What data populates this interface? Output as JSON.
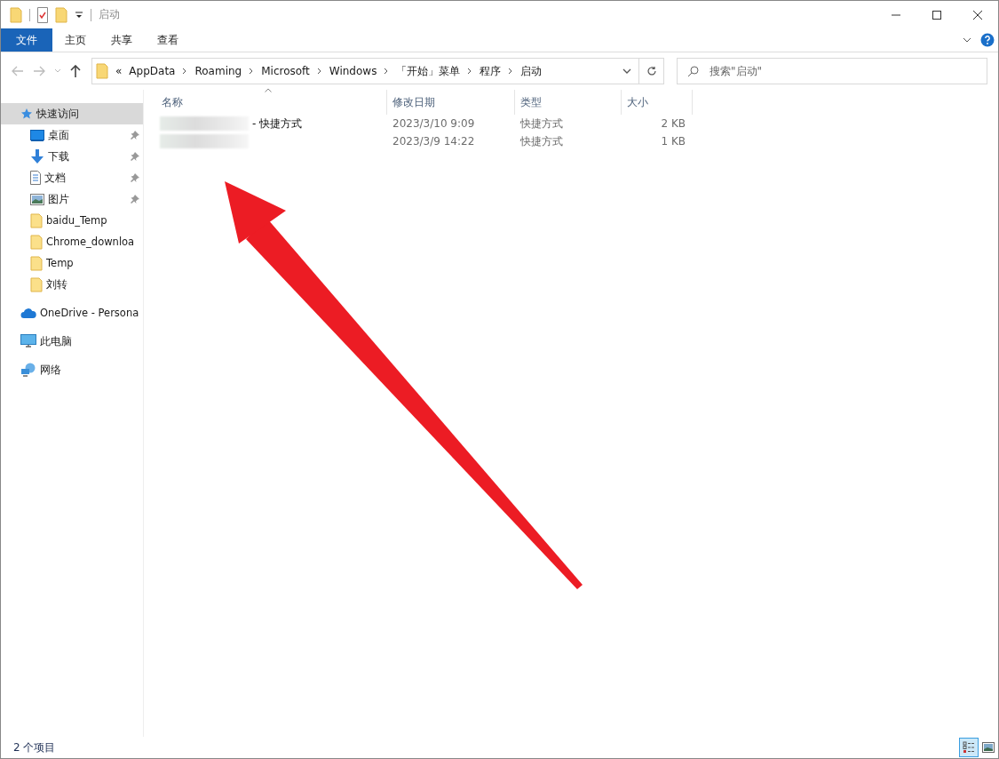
{
  "window": {
    "title": "启动"
  },
  "ribbon_tabs": [
    {
      "label": "文件",
      "kind": "file",
      "selected": false
    },
    {
      "label": "主页",
      "kind": "tab",
      "selected": false
    },
    {
      "label": "共享",
      "kind": "tab",
      "selected": false
    },
    {
      "label": "查看",
      "kind": "tab",
      "selected": false
    }
  ],
  "address_bar": {
    "overflow": "«",
    "crumbs": [
      "AppData",
      "Roaming",
      "Microsoft",
      "Windows",
      "「开始」菜单",
      "程序",
      "启动"
    ]
  },
  "search": {
    "placeholder": "搜索\"启动\""
  },
  "sidebar": {
    "items": [
      {
        "label": "快速访问",
        "kind": "star",
        "selected": true,
        "children": [
          {
            "label": "桌面",
            "kind": "desktop",
            "pinned": true,
            "selected": false
          },
          {
            "label": "下载",
            "kind": "download",
            "pinned": true,
            "selected": false
          },
          {
            "label": "文档",
            "kind": "document",
            "pinned": true,
            "selected": false
          },
          {
            "label": "图片",
            "kind": "picture",
            "pinned": true,
            "selected": false
          },
          {
            "label": "baidu_Temp",
            "kind": "folder",
            "pinned": false,
            "selected": false
          },
          {
            "label": "Chrome_downloa",
            "kind": "folder",
            "pinned": false,
            "selected": false
          },
          {
            "label": "Temp",
            "kind": "folder",
            "pinned": false,
            "selected": false
          },
          {
            "label": "刘转",
            "kind": "folder",
            "pinned": false,
            "selected": false
          }
        ]
      },
      {
        "label": "OneDrive - Persona",
        "kind": "onedrive",
        "selected": false
      },
      {
        "label": "此电脑",
        "kind": "pc",
        "selected": false
      },
      {
        "label": "网络",
        "kind": "network",
        "selected": false
      }
    ]
  },
  "table": {
    "columns": [
      {
        "label": "名称",
        "sorted": true
      },
      {
        "label": "修改日期",
        "sorted": false
      },
      {
        "label": "类型",
        "sorted": false
      },
      {
        "label": "大小",
        "sorted": false
      }
    ],
    "rows": [
      {
        "name": "- 快捷方式",
        "redacted": true,
        "modified": "2023/3/10 9:09",
        "type": "快捷方式",
        "size": "2 KB"
      },
      {
        "redacted": true,
        "modified": "2023/3/9 14:22",
        "type": "快捷方式",
        "size": "1 KB"
      }
    ]
  },
  "status_bar": {
    "count": "2 个项目",
    "views": [
      {
        "kind": "details",
        "selected": true
      },
      {
        "kind": "large",
        "selected": false
      }
    ]
  },
  "annotation": {
    "kind": "arrow"
  }
}
